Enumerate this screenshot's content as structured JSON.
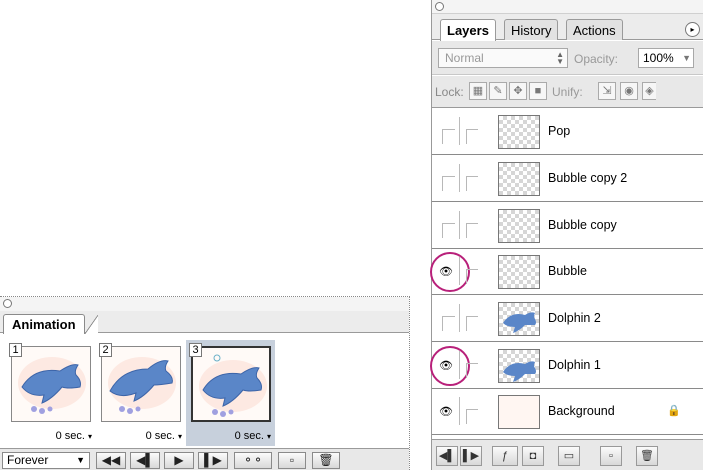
{
  "animation": {
    "tab": "Animation",
    "frames": [
      {
        "number": "1",
        "delay": "0 sec.",
        "selected": false
      },
      {
        "number": "2",
        "delay": "0 sec.",
        "selected": false
      },
      {
        "number": "3",
        "delay": "0 sec.",
        "selected": true
      }
    ],
    "delay_arrow": "▾",
    "loop": "Forever",
    "loop_arrow": "▼",
    "controls": {
      "first": "◀◀",
      "prev": "◀▌",
      "play": "▶",
      "next": "▌▶",
      "tween": "⚬⚬",
      "new_frame": "▫",
      "delete": "🗑"
    }
  },
  "layers_panel": {
    "tabs": [
      "Layers",
      "History",
      "Actions"
    ],
    "menu_glyph": "▸",
    "blend_mode": "Normal",
    "opacity_label": "Opacity:",
    "opacity_value": "100%",
    "lock_label": "Lock:",
    "unify_label": "Unify:",
    "eye_glyph": "👁",
    "lock_glyph": "🔒",
    "layers": [
      {
        "name": "Pop",
        "visible": false,
        "circled": false
      },
      {
        "name": "Bubble copy 2",
        "visible": false,
        "circled": false
      },
      {
        "name": "Bubble copy",
        "visible": false,
        "circled": false
      },
      {
        "name": "Bubble",
        "visible": true,
        "circled": true
      },
      {
        "name": "Dolphin 2",
        "visible": false,
        "circled": false
      },
      {
        "name": "Dolphin 1",
        "visible": true,
        "circled": true
      },
      {
        "name": "Background",
        "visible": true,
        "circled": false,
        "locked": true
      }
    ]
  }
}
